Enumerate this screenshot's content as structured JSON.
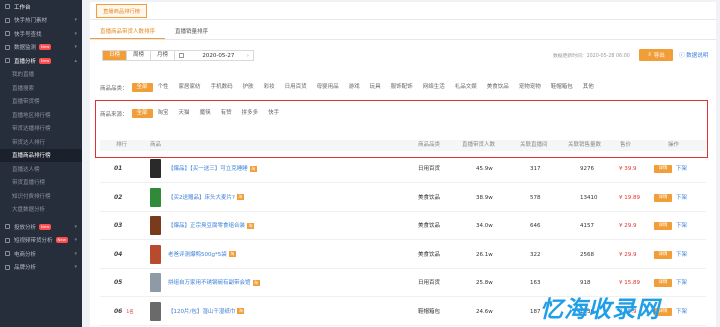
{
  "sidebar": {
    "items": [
      {
        "label": "工作台",
        "kind": "top",
        "arrow": ""
      },
      {
        "label": "快手热门素材",
        "kind": "group",
        "arrow": "▾"
      },
      {
        "label": "快手号查找",
        "kind": "group",
        "arrow": "▾"
      },
      {
        "label": "数据监测",
        "kind": "group",
        "arrow": "▾",
        "badge": "New"
      },
      {
        "label": "直播分析",
        "kind": "open",
        "arrow": "▴",
        "badge": "New"
      },
      {
        "label": "我的直播",
        "kind": "sub"
      },
      {
        "label": "直播搜索",
        "kind": "sub"
      },
      {
        "label": "直播带货榜",
        "kind": "sub"
      },
      {
        "label": "直播地区排行榜",
        "kind": "sub"
      },
      {
        "label": "带货达播排行榜",
        "kind": "sub"
      },
      {
        "label": "带货达人排行",
        "kind": "sub"
      },
      {
        "label": "直播商品排行榜",
        "kind": "sub-active"
      },
      {
        "label": "直播达人榜",
        "kind": "sub"
      },
      {
        "label": "带货直播行榜",
        "kind": "sub"
      },
      {
        "label": "知识付费排行榜",
        "kind": "sub"
      },
      {
        "label": "大盘数据分析",
        "kind": "sub"
      },
      {
        "label": "",
        "kind": "sep"
      },
      {
        "label": "投放分析",
        "kind": "group",
        "arrow": "▾",
        "badge": "New"
      },
      {
        "label": "短视频带货分析",
        "kind": "group",
        "arrow": "▾",
        "badge": "New"
      },
      {
        "label": "电商分析",
        "kind": "group",
        "arrow": "▾"
      },
      {
        "label": "品牌分析",
        "kind": "group",
        "arrow": "▾"
      }
    ]
  },
  "breadcrumb": {
    "label": "直播商品排行榜"
  },
  "subtabs": [
    {
      "label": "直播商品带货人数排序",
      "active": true
    },
    {
      "label": "直播销量排序",
      "active": false
    }
  ],
  "toolbar": {
    "periods": [
      {
        "label": "日榜",
        "active": true
      },
      {
        "label": "周榜",
        "active": false
      },
      {
        "label": "月榜",
        "active": false
      }
    ],
    "date": "2020-05-27",
    "date_chevron": "›",
    "update_note": "数据更新时间：2020-05-28 06:00",
    "export_label": "导出",
    "help_label": "数据说明"
  },
  "categories": {
    "label": "商品品类：",
    "items": [
      {
        "label": "全部",
        "active": true
      },
      {
        "label": "个性",
        "active": false
      },
      {
        "label": "家居家纺",
        "active": false
      },
      {
        "label": "手机数码",
        "active": false
      },
      {
        "label": "护肤",
        "active": false
      },
      {
        "label": "彩妆",
        "active": false
      },
      {
        "label": "日用百货",
        "active": false
      },
      {
        "label": "母婴用品",
        "active": false
      },
      {
        "label": "游戏",
        "active": false
      },
      {
        "label": "玩具",
        "active": false
      },
      {
        "label": "服饰配饰",
        "active": false
      },
      {
        "label": "网络生活",
        "active": false
      },
      {
        "label": "礼品文娱",
        "active": false
      },
      {
        "label": "美食饮品",
        "active": false
      },
      {
        "label": "宠物宠物",
        "active": false
      },
      {
        "label": "鞋帽箱包",
        "active": false
      },
      {
        "label": "其他",
        "active": false
      }
    ]
  },
  "sources": {
    "label": "商品来源：",
    "items": [
      {
        "label": "全部",
        "active": true
      },
      {
        "label": "淘宝",
        "active": false
      },
      {
        "label": "天猫",
        "active": false
      },
      {
        "label": "魔筷",
        "active": false
      },
      {
        "label": "有赞",
        "active": false
      },
      {
        "label": "拼多多",
        "active": false
      },
      {
        "label": "快手",
        "active": false
      }
    ]
  },
  "table": {
    "headers": {
      "rank": "排行",
      "product": "商品",
      "category": "商品品类",
      "live_users": "直播带货人数",
      "fans_users": "关联直播间",
      "total_sales": "关联销售量数",
      "price": "售价",
      "ops": "操作"
    },
    "detail_label": "详情",
    "down_label": "下架",
    "rows": [
      {
        "rank": "01",
        "change": "",
        "name": "【爆品】【买一送三】可立克睡睡",
        "tag": "淘",
        "category": "日用百货",
        "live": "45.9w",
        "fans": "317",
        "sales": "9276",
        "price": "¥ 39.9",
        "thumb": "#2a2a2a"
      },
      {
        "rank": "02",
        "change": "",
        "name": "【买2送赠品】床头大麦片?",
        "tag": "淘",
        "category": "美食饮品",
        "live": "38.9w",
        "fans": "578",
        "sales": "13410",
        "price": "¥ 19.89",
        "thumb": "#2f8a3a"
      },
      {
        "rank": "03",
        "change": "",
        "name": "【爆品】正宗臭豆腐零食组合装",
        "tag": "淘",
        "category": "美食饮品",
        "live": "34.0w",
        "fans": "646",
        "sales": "4157",
        "price": "¥ 29.9",
        "thumb": "#7a3b1d"
      },
      {
        "rank": "04",
        "change": "",
        "name": "老爸评测爆鸭500g*5袋",
        "tag": "淘",
        "category": "美食饮品",
        "live": "26.1w",
        "fans": "322",
        "sales": "2568",
        "price": "¥ 29.9",
        "thumb": "#b84a2e"
      },
      {
        "rank": "05",
        "change": "",
        "name": "拼组自万家用不锈钢碗有副带会馆",
        "tag": "淘",
        "category": "日用百货",
        "live": "25.8w",
        "fans": "163",
        "sales": "918",
        "price": "¥ 15.89",
        "thumb": "#8e9aa6"
      },
      {
        "rank": "06",
        "change": "1名",
        "name": "【120片/包】湿山干湿纸巾",
        "tag": "淘",
        "category": "鞋帽箱包",
        "live": "24.6w",
        "fans": "187",
        "sales": "1630",
        "price": "¥ 39.9",
        "thumb": "#6a6a6a"
      }
    ]
  },
  "watermark": "忆海收录网",
  "colors": {
    "accent": "#f29e38",
    "link": "#3b7fd9",
    "price": "#e03131",
    "sidebar_bg": "#262d3b",
    "highlight": "#e03131"
  }
}
